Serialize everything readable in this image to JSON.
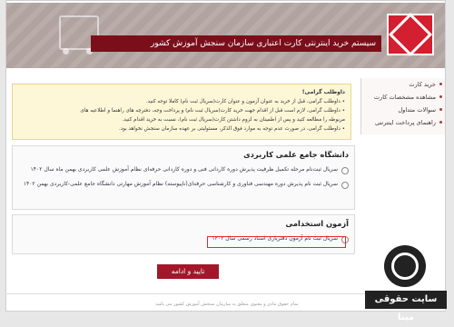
{
  "banner": {
    "title": "سیستم خرید اینترنتی کارت اعتباری سازمان سنجش آموزش کشور"
  },
  "sidebar": {
    "items": [
      {
        "label": "خرید کارت"
      },
      {
        "label": "مشاهده مشخصات کارت"
      },
      {
        "label": "سوالات متداول"
      },
      {
        "label": "راهنمای پرداخت اینترنتی"
      }
    ]
  },
  "notice": {
    "title": "داوطلب گرامی!",
    "lines": [
      "• داوطلب گرامی، قبل از خرید به عنوان آزمون و عنوان کارت(سریال ثبت نام) کاملا توجه کنید.",
      "• داوطلب گرامی، لازم است قبل از اقدام جهت خرید کارت(سریال ثبت نام) و پرداخت وجه، دفترچه های راهنما و اطلاعیه های",
      "مربوطه را مطالعه کنید و پس از اطمینان به لزوم داشتن کارت(سریال ثبت نام)، نسبت به خرید اقدام کنید.",
      "• داوطلب گرامی، در صورت عدم توجه به موارد فوق الذکر، مسئولیتی بر عهده سازمان سنجش نخواهد بود."
    ]
  },
  "sections": [
    {
      "title": "دانشگاه جامع علمی کاربردی",
      "options": [
        "سریال ثبت‌نام مرحله تکمیل ظرفیت پذیرش دوره کاردانی فنی و دوره کاردانی حرفه‌ای نظام آموزش علمی کاربردی بهمن ماه سال ۱۴۰۲",
        "سریال ثبت نام پذیرش دوره مهندسی فناوری و کارشناسی حرفه‌ای(ناپیوسته) نظام آموزش مهارتی دانشگاه جامع علمی-کاربردی بهمن ۱۴۰۲"
      ]
    },
    {
      "title": "آزمون استخدامی",
      "options": [
        "سریال ثبت نام آزمون دفتریاری اسناد رسمی سال ۱۴۰۲"
      ]
    }
  ],
  "submit_label": "تایید و ادامه",
  "footer": "تمام حقوق مادی و معنوی متعلق به سازمان سنجش آموزش کشور می باشد",
  "watermark": "سایت حقوقی مینا"
}
